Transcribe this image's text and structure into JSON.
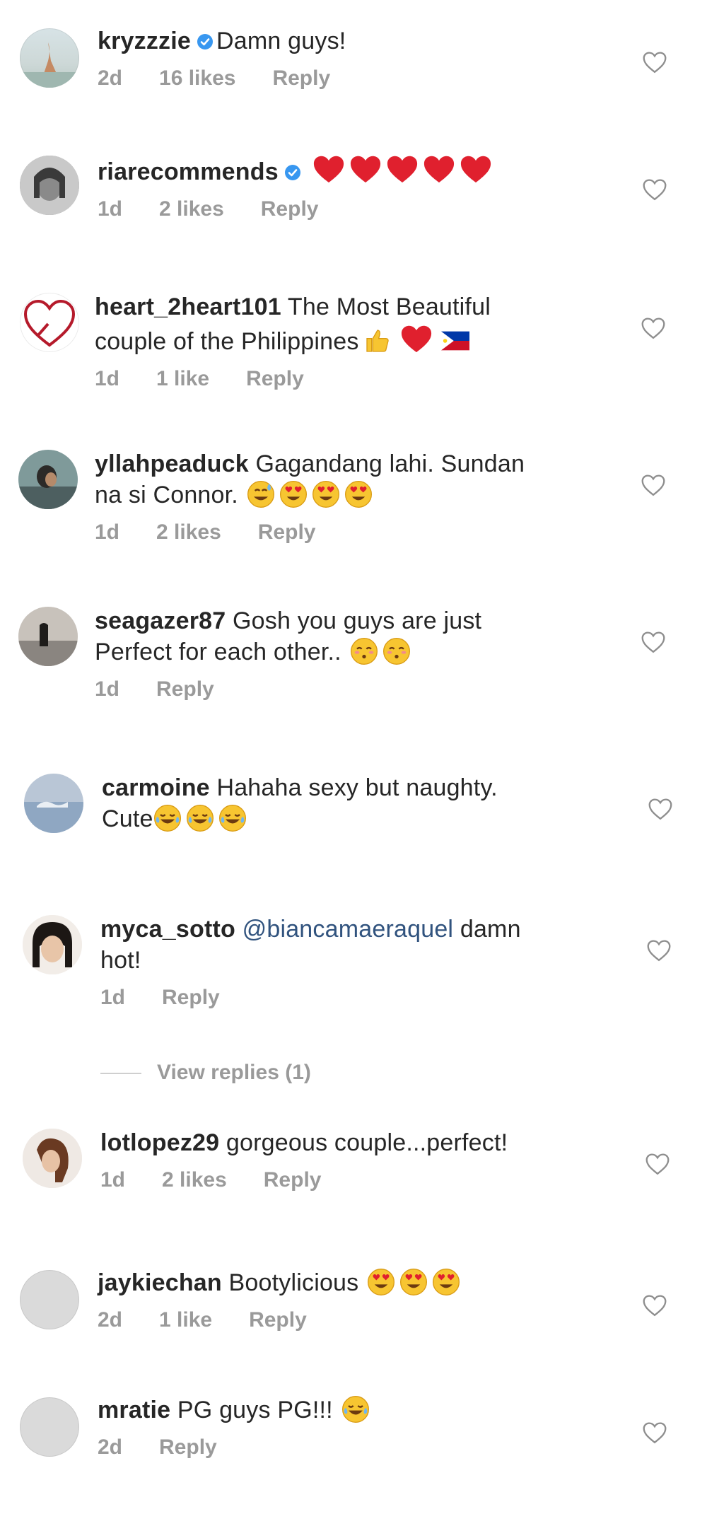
{
  "icons": {
    "heart_outline": "heart-outline-icon",
    "verified": "verified-badge-icon",
    "red_heart": "red-heart-emoji",
    "thumbs_up": "thumbs-up-emoji",
    "flag": "philippines-flag-emoji",
    "heart_eyes": "heart-eyes-emoji",
    "sweat_smile": "sweat-smile-emoji",
    "kissing": "kissing-smiling-eyes-emoji",
    "joy": "tears-of-joy-emoji"
  },
  "colors": {
    "verified": "#3897f0",
    "secondary_text": "#9a9a9a",
    "mention": "#31537e"
  },
  "comments": [
    {
      "username": "kryzzzie",
      "text": "Damn guys!",
      "time": "2d",
      "likes": "16 likes",
      "reply": "Reply"
    },
    {
      "username": "riarecommends",
      "text": "",
      "time": "1d",
      "likes": "2 likes",
      "reply": "Reply"
    },
    {
      "username": "heart_2heart101",
      "text_line1": "The Most Beautiful",
      "text_line2": "couple of the Philippines",
      "time": "1d",
      "likes": "1 like",
      "reply": "Reply"
    },
    {
      "username": "yllahpeaduck",
      "text_line1": "Gagandang lahi. Sundan",
      "text_line2": "na si Connor.",
      "time": "1d",
      "likes": "2 likes",
      "reply": "Reply"
    },
    {
      "username": "seagazer87",
      "text_line1": "Gosh you guys are just",
      "text_line2": "Perfect for each other..",
      "time": "1d",
      "reply": "Reply"
    },
    {
      "username": "carmoine",
      "text_line1": "Hahaha sexy but naughty.",
      "text_line2": "Cute"
    },
    {
      "username": "myca_sotto",
      "mention": "@biancamaeraquel",
      "text_line1": "damn",
      "text_line2": "hot!",
      "time": "1d",
      "reply": "Reply",
      "view_replies": "View replies (1)"
    },
    {
      "username": "lotlopez29",
      "text": "gorgeous couple...perfect!",
      "time": "1d",
      "likes": "2 likes",
      "reply": "Reply"
    },
    {
      "username": "jaykiechan",
      "text": "Bootylicious",
      "time": "2d",
      "likes": "1 like",
      "reply": "Reply"
    },
    {
      "username": "mratie",
      "text": "PG guys PG!!!",
      "time": "2d",
      "reply": "Reply"
    }
  ]
}
